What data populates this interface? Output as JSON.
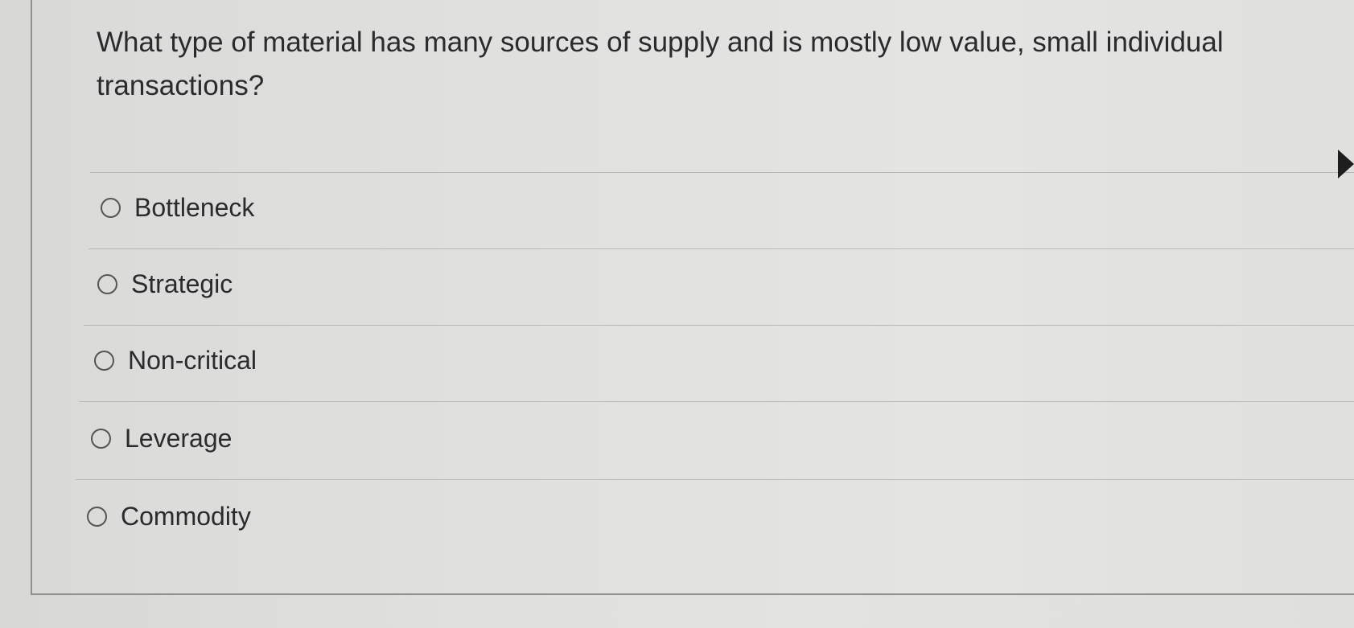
{
  "question": {
    "text": "What type of material has many sources of supply and is mostly low value, small individual transactions?"
  },
  "options": [
    {
      "label": "Bottleneck",
      "selected": false
    },
    {
      "label": "Strategic",
      "selected": false
    },
    {
      "label": "Non-critical",
      "selected": false
    },
    {
      "label": "Leverage",
      "selected": false
    },
    {
      "label": "Commodity",
      "selected": false
    }
  ],
  "colors": {
    "background": "#e0e0de",
    "text": "#2b2b2d",
    "divider": "#b7b7b5",
    "panel_border": "#8f8f8f"
  }
}
